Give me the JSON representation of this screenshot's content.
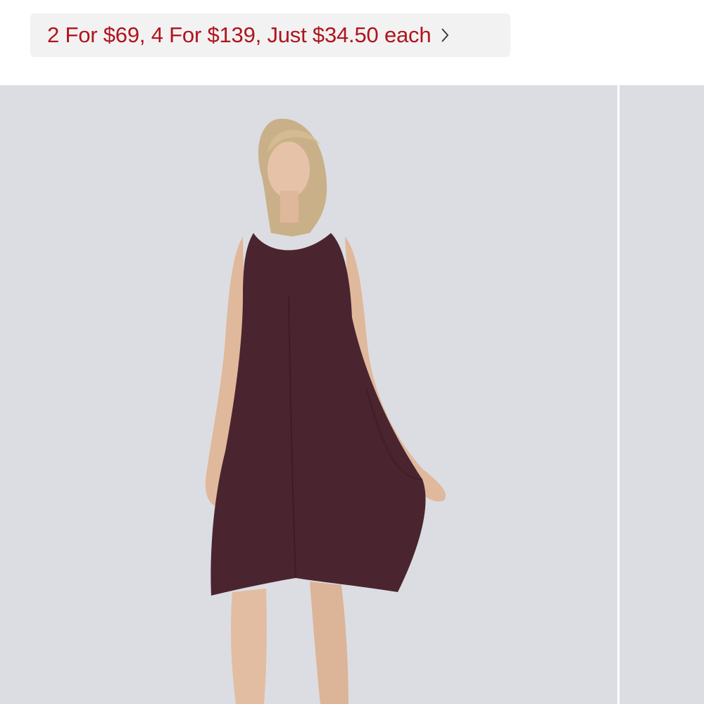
{
  "promo": {
    "text": "2 For $69, 4 For $139, Just $34.50 each",
    "chevron_icon": "chevron-right-icon",
    "text_color": "#b0141b",
    "background": "#f2f2f3"
  },
  "gallery": {
    "main_image": "product-photo",
    "next_image": "product-photo-next",
    "background": "#dcdde2",
    "dress_color": "#4a2530"
  }
}
